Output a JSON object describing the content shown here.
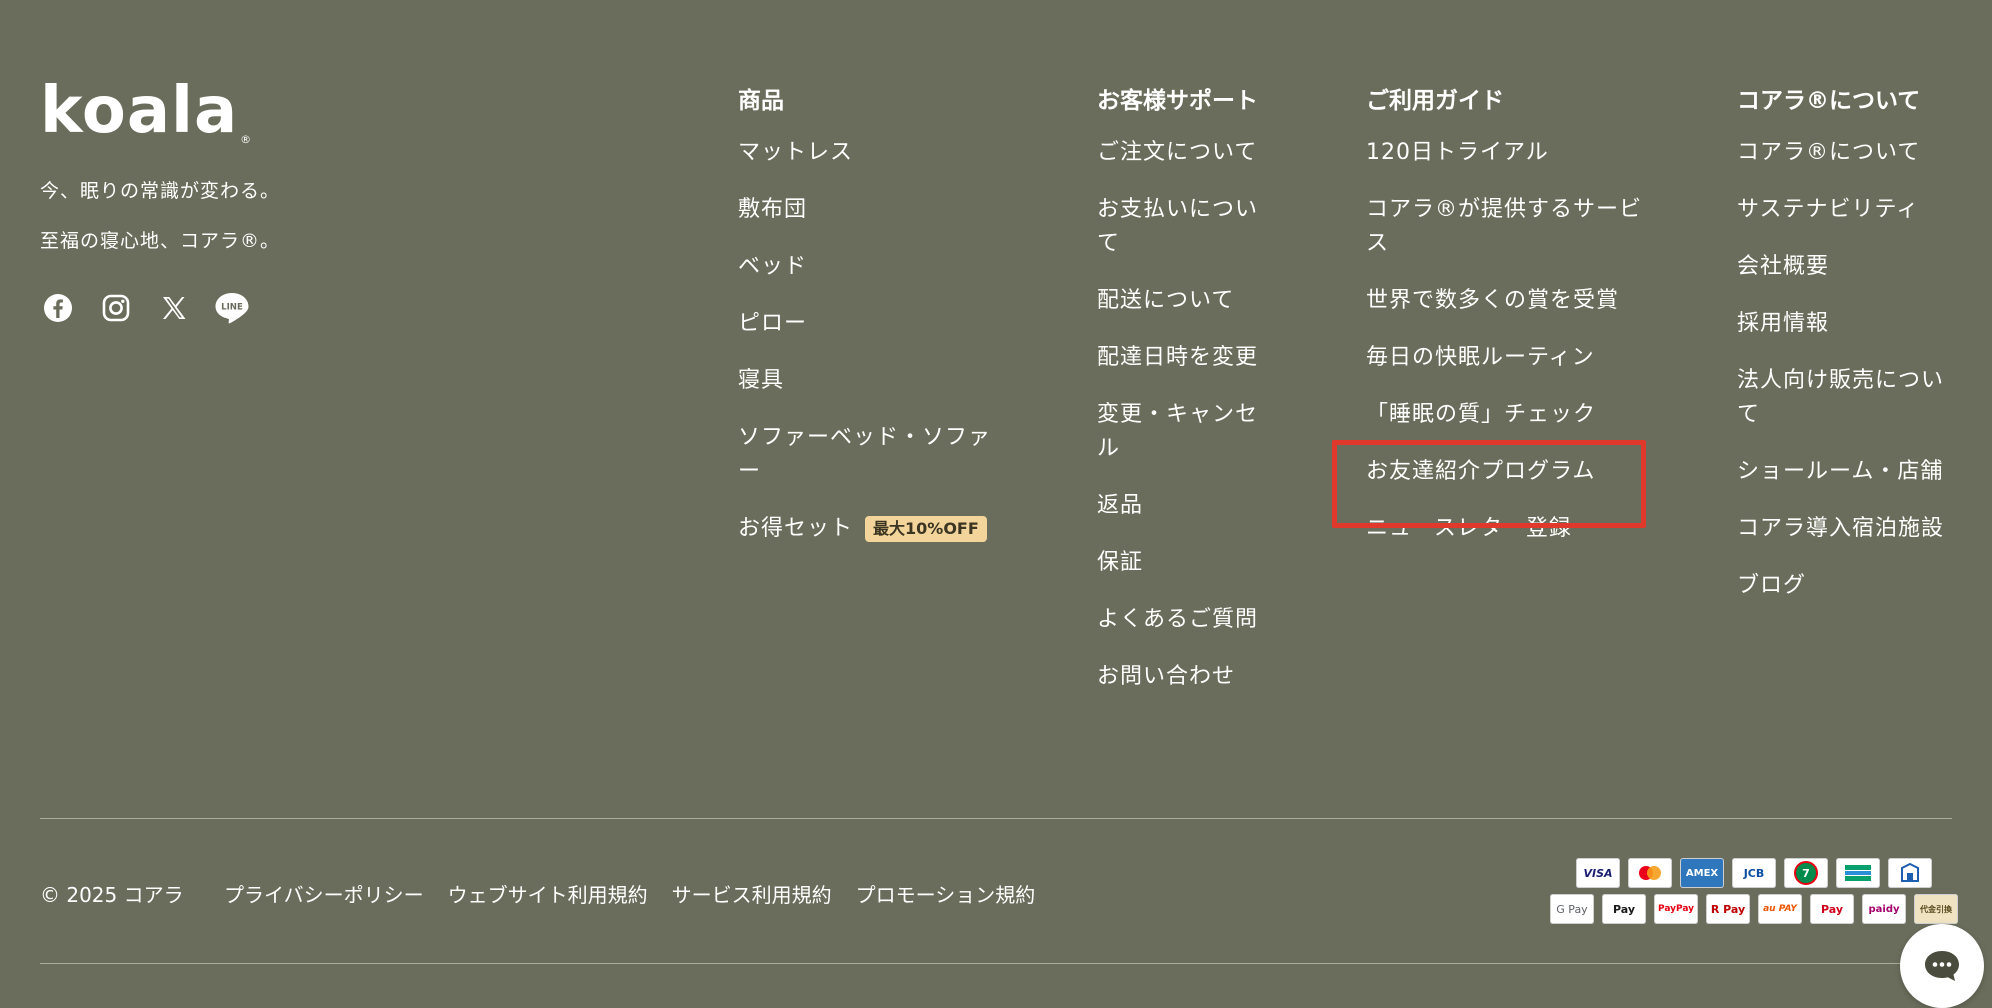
{
  "brand": {
    "logo_text": "koala",
    "tagline1": "今、眠りの常識が変わる。",
    "tagline2": "至福の寝心地、コアラ®。"
  },
  "social": {
    "icons": [
      "facebook-icon",
      "instagram-icon",
      "x-icon",
      "line-icon"
    ]
  },
  "columns": {
    "products": {
      "title": "商品",
      "items": [
        "マットレス",
        "敷布団",
        "ベッド",
        "ピロー",
        "寝具",
        "ソファーベッド・ソファ\nー",
        "お得セット"
      ],
      "badge": "最大10%OFF"
    },
    "support": {
      "title": "お客様サポート",
      "items": [
        "ご注文について",
        "お支払いについ\nて",
        "配送について",
        "配達日時を変更",
        "変更・キャンセ\nル",
        "返品",
        "保証",
        "よくあるご質問",
        "お問い合わせ"
      ]
    },
    "guide": {
      "title": "ご利用ガイド",
      "items": [
        "120日トライアル",
        "コアラ®が提供するサービ\nス",
        "世界で数多くの賞を受賞",
        "毎日の快眠ルーティン",
        "「睡眠の質」チェック",
        "お友達紹介プログラム",
        "ニュースレター登録"
      ]
    },
    "about": {
      "title": "コアラ®について",
      "items": [
        "コアラ®について",
        "サステナビリティ",
        "会社概要",
        "採用情報",
        "法人向け販売につい\nて",
        "ショールーム・店舗",
        "コアラ導入宿泊施設",
        "ブログ"
      ]
    }
  },
  "footer": {
    "copyright": "© 2025 コアラ",
    "links": [
      "プライバシーポリシー",
      "ウェブサイト利用規約",
      "サービス利用規約",
      "プロモーション規約"
    ]
  },
  "payments": {
    "row1": [
      "VISA",
      "MC",
      "AMEX",
      "JCB",
      "7",
      "BANK",
      "CVS"
    ],
    "row2": [
      "G Pay",
      "Pay",
      "PayPay",
      "R Pay",
      "au PAY",
      "Pay",
      "paidy",
      "代金引換"
    ]
  },
  "colors": {
    "background": "#6a6d5b",
    "highlight": "#e0382b",
    "badge": "#f3d49a"
  }
}
